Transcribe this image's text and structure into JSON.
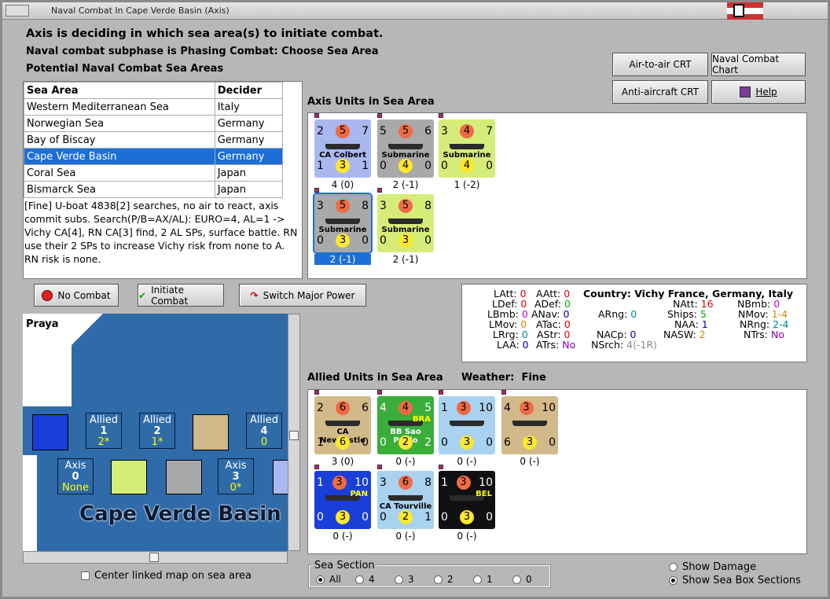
{
  "window": {
    "title": "Naval Combat In Cape Verde Basin (Axis)"
  },
  "header": {
    "line1": "Axis is deciding in which sea area(s) to initiate combat.",
    "line2": "Naval combat subphase is Phasing Combat: Choose Sea Area",
    "line3": "Potential Naval Combat Sea Areas"
  },
  "buttons": {
    "air_to_air": "Air-to-air CRT",
    "naval_chart": "Naval Combat Chart",
    "anti_aircraft": "Anti-aircraft CRT",
    "help": "Help",
    "no_combat": "No Combat",
    "initiate_combat": "Initiate Combat",
    "switch_power": "Switch Major Power"
  },
  "sea_table": {
    "headers": [
      "Sea Area",
      "Decider"
    ],
    "rows": [
      [
        "Western Mediterranean Sea",
        "Italy"
      ],
      [
        "Norwegian Sea",
        "Germany"
      ],
      [
        "Bay of Biscay",
        "Germany"
      ],
      [
        "Cape Verde Basin",
        "Germany"
      ],
      [
        "Coral Sea",
        "Japan"
      ],
      [
        "Bismarck Sea",
        "Japan"
      ]
    ],
    "selected": 3
  },
  "message": "[Fine] U-boat 4838[2] searches, no air to react, axis commit subs. Search(P/B=AX/AL): EURO=4, AL=1 -> Vichy CA[4], RN CA[3] find, 2 AL SPs, surface battle. RN use their 2 SPs to increase Vichy risk from none to A. RN risk is none.",
  "axis_units": {
    "label": "Axis Units in Sea Area",
    "units": [
      {
        "name": "CA Colbert",
        "top": [
          "2",
          "5",
          "7"
        ],
        "bot": [
          "1",
          "3",
          "1"
        ],
        "tag": "4 (0)",
        "color": "#aab8f0"
      },
      {
        "name": "Submarine",
        "top": [
          "5",
          "5",
          "6"
        ],
        "bot": [
          "0",
          "4",
          "0"
        ],
        "tag": "2 (-1)",
        "color": "#a9a9a9"
      },
      {
        "name": "Submarine",
        "top": [
          "3",
          "4",
          "7"
        ],
        "bot": [
          "0",
          "4",
          "0"
        ],
        "tag": "1 (-2)",
        "color": "#d6ec78"
      },
      {
        "name": "Submarine",
        "top": [
          "3",
          "5",
          "8"
        ],
        "bot": [
          "0",
          "3",
          "0"
        ],
        "tag": "2 (-1)",
        "color": "#a9a9a9"
      },
      {
        "name": "Submarine",
        "top": [
          "3",
          "5",
          "8"
        ],
        "bot": [
          "0",
          "3",
          "0"
        ],
        "tag": "2 (-1)",
        "color": "#d6ec78"
      }
    ]
  },
  "stats": {
    "country_label": "Country:",
    "country": "Vichy France, Germany, Italy",
    "LAtt": "0",
    "LDef": "0",
    "LBmb": "0",
    "LMov": "0",
    "LRrg": "0",
    "LAA": "0",
    "AAtt": "0",
    "ADef": "0",
    "ANav": "0",
    "ATac": "0",
    "AStr": "0",
    "ATrs": "No",
    "ARng": "0",
    "NACp": "0",
    "NSrch": "4(-1R)",
    "NAtt": "16",
    "Ships": "5",
    "NAA": "1",
    "NASW": "2",
    "NBmb": "0",
    "NMov": "1-4",
    "NRng": "2-4",
    "NTrs": "No"
  },
  "allied_units": {
    "label": "Allied Units in Sea Area",
    "weather_label": "Weather:",
    "weather": "Fine",
    "units": [
      {
        "name": "CA Newcastle",
        "top": [
          "2",
          "6",
          "6"
        ],
        "bot": [
          "1",
          "6",
          "0"
        ],
        "tag": "3 (0)",
        "color": "#d2b98a"
      },
      {
        "name": "BB Sao Paulo",
        "nation": "BRA",
        "top": [
          "4",
          "4",
          "5"
        ],
        "bot": [
          "0",
          "2",
          "2"
        ],
        "tag": "0 (-)",
        "color": "#3aad3a"
      },
      {
        "name": "",
        "top": [
          "1",
          "3",
          "10"
        ],
        "bot": [
          "0",
          "3",
          "0"
        ],
        "tag": "0 (-)",
        "color": "#a8d2ef"
      },
      {
        "name": "",
        "top": [
          "4",
          "3",
          "10"
        ],
        "bot": [
          "6",
          "3",
          "0"
        ],
        "tag": "0 (-)",
        "color": "#d2b98a"
      },
      {
        "name": "",
        "nation": "PAN",
        "top": [
          "1",
          "3",
          "10"
        ],
        "bot": [
          "0",
          "3",
          "0"
        ],
        "tag": "0 (-)",
        "color": "#1a3fd8"
      },
      {
        "name": "CA Tourville",
        "top": [
          "3",
          "6",
          "8"
        ],
        "bot": [
          "0",
          "2",
          "1"
        ],
        "tag": "0 (-)",
        "color": "#a8d2ef"
      },
      {
        "name": "",
        "nation": "BEL",
        "top": [
          "1",
          "3",
          "10"
        ],
        "bot": [
          "0",
          "3",
          "0"
        ],
        "tag": "0 (-)",
        "color": "#111111"
      }
    ]
  },
  "map": {
    "place": "Praya",
    "sea_name": "Cape Verde Basin",
    "allied_boxes": [
      {
        "l1": "Allied",
        "l2": "1",
        "l3": "2*"
      },
      {
        "l1": "Allied",
        "l2": "2",
        "l3": "1*"
      },
      {
        "l1": "Allied",
        "l2": "4",
        "l3": "0"
      }
    ],
    "axis_boxes": [
      {
        "l1": "Axis",
        "l2": "0",
        "l3": "None"
      },
      {
        "l1": "Axis",
        "l2": "3",
        "l3": "0*"
      }
    ]
  },
  "center_linked": "Center linked map on sea area",
  "sea_section": {
    "label": "Sea Section",
    "options": [
      "All",
      "4",
      "3",
      "2",
      "1",
      "0"
    ],
    "selected": "All"
  },
  "display": {
    "show_damage": "Show Damage",
    "show_boxes": "Show Sea Box Sections"
  }
}
